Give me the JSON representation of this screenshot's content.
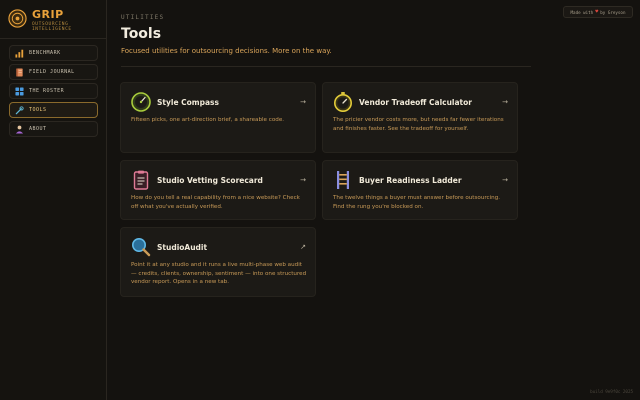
{
  "brand": {
    "title": "GRIP",
    "subtitle_line1": "OUTSOURCING",
    "subtitle_line2": "INTELLIGENCE"
  },
  "sidebar": {
    "items": [
      {
        "label": "BENCHMARK",
        "icon": "bar-chart-icon",
        "active": false
      },
      {
        "label": "FIELD JOURNAL",
        "icon": "journal-icon",
        "active": false
      },
      {
        "label": "THE ROSTER",
        "icon": "grid-icon",
        "active": false
      },
      {
        "label": "TOOLS",
        "icon": "tools-icon",
        "active": true
      },
      {
        "label": "ABOUT",
        "icon": "person-icon",
        "active": false
      }
    ]
  },
  "made_with": {
    "prefix": "Made with",
    "suffix": "by Greyson"
  },
  "header": {
    "eyebrow": "UTILITIES",
    "title": "Tools",
    "subtitle": "Focused utilities for outsourcing decisions. More on the way."
  },
  "tools": [
    {
      "title": "Style Compass",
      "arrow": "→",
      "icon": "compass-icon",
      "description": "Fifteen picks, one art-direction brief, a shareable code."
    },
    {
      "title": "Vendor Tradeoff Calculator",
      "arrow": "→",
      "icon": "stopwatch-icon",
      "description": "The pricier vendor costs more, but needs far fewer iterations and finishes faster. See the tradeoff for yourself."
    },
    {
      "title": "Studio Vetting Scorecard",
      "arrow": "→",
      "icon": "clipboard-icon",
      "description": "How do you tell a real capability from a nice website? Check off what you've actually verified."
    },
    {
      "title": "Buyer Readiness Ladder",
      "arrow": "→",
      "icon": "ladder-icon",
      "description": "The twelve things a buyer must answer before outsourcing. Find the rung you're blocked on."
    },
    {
      "title": "StudioAudit",
      "arrow": "↗",
      "icon": "magnifier-icon",
      "description": "Point it at any studio and it runs a live multi-phase web audit — credits, clients, ownership, sentiment — into one structured vendor report. Opens in a new tab."
    }
  ],
  "footer": {
    "note": "build 9e9f0c 2025"
  },
  "colors": {
    "accent": "#e9a23b",
    "subtitle": "#d9a45a",
    "background": "#14120f",
    "card": "#1c1a16"
  }
}
